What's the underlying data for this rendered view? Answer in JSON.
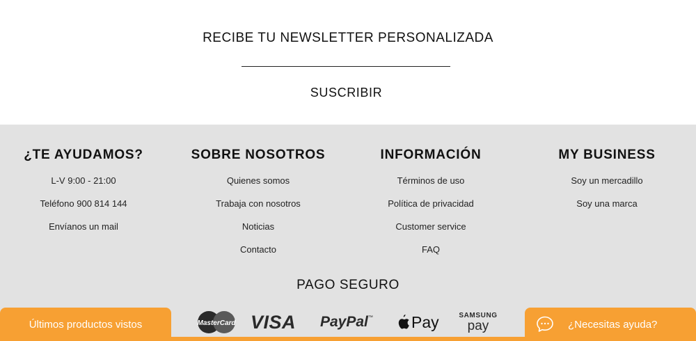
{
  "newsletter": {
    "title": "RECIBE TU NEWSLETTER PERSONALIZADA",
    "email_value": "",
    "email_placeholder": "",
    "submit_label": "SUSCRIBIR"
  },
  "footer": {
    "columns": [
      {
        "title": "¿TE AYUDAMOS?",
        "items": [
          "L-V 9:00 - 21:00",
          "Teléfono 900 814 144",
          "Envíanos un mail"
        ]
      },
      {
        "title": "SOBRE NOSOTROS",
        "items": [
          "Quienes somos",
          "Trabaja con nosotros",
          "Noticias",
          "Contacto"
        ]
      },
      {
        "title": "INFORMACIÓN",
        "items": [
          "Términos de uso",
          "Política de privacidad",
          "Customer service",
          "FAQ"
        ]
      },
      {
        "title": "MY BUSINESS",
        "items": [
          "Soy un mercadillo",
          "Soy una marca"
        ]
      }
    ],
    "payment": {
      "title": "PAGO SEGURO",
      "logos": [
        {
          "icon": "mastercard-logo",
          "text": "MasterCard"
        },
        {
          "icon": "visa-logo",
          "text": "VISA"
        },
        {
          "icon": "paypal-logo",
          "text": "PayPal"
        },
        {
          "icon": "apple-pay-logo",
          "text": "Pay"
        },
        {
          "icon": "samsung-pay-logo",
          "text_top": "SAMSUNG",
          "text_bottom": "pay"
        }
      ]
    }
  },
  "bottom_bar": {
    "recent_label": "Últimos productos vistos",
    "help_label": "¿Necesitas ayuda?",
    "help_icon": "chat-bubble-icon",
    "accent_color": "#f7a033"
  }
}
